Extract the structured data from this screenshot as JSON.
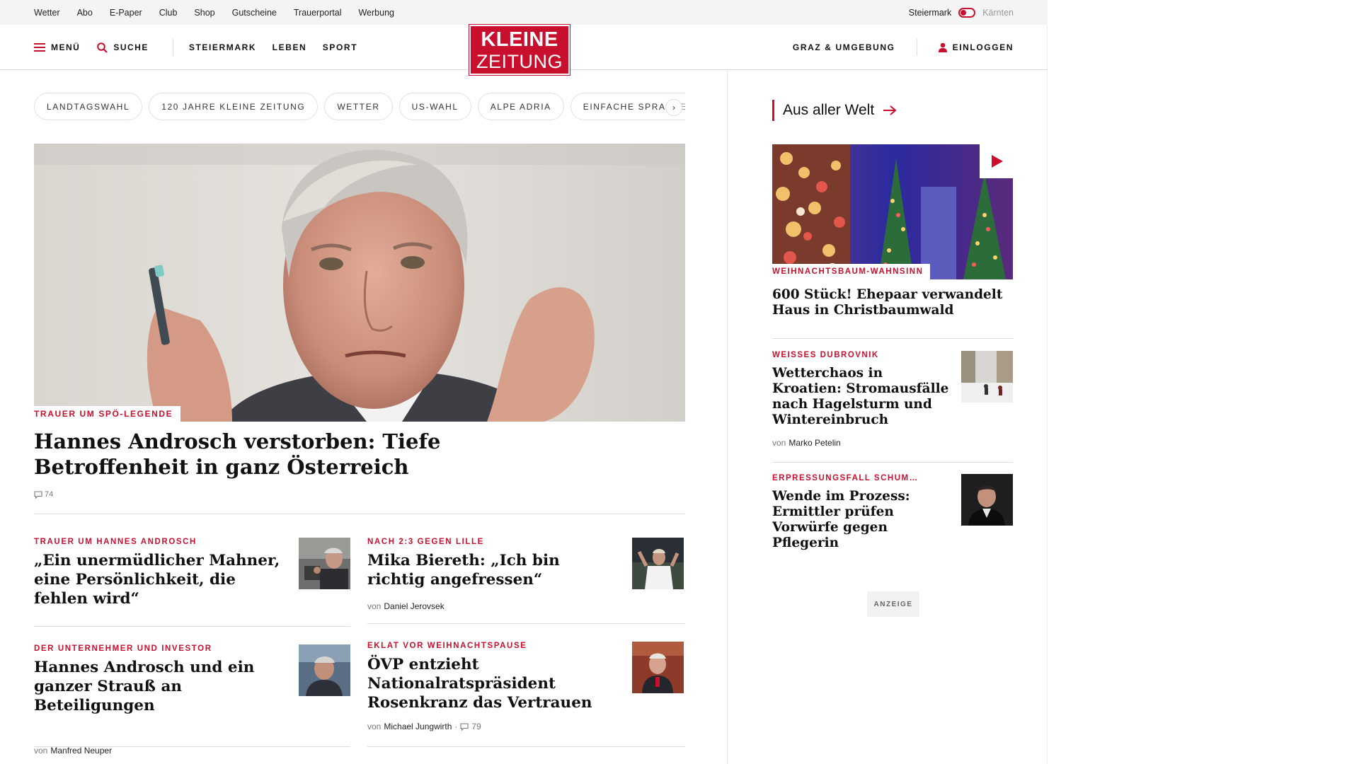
{
  "topbar": {
    "links": [
      "Wetter",
      "Abo",
      "E-Paper",
      "Club",
      "Shop",
      "Gutscheine",
      "Trauerportal",
      "Werbung"
    ],
    "region_active": "Steiermark",
    "region_inactive": "Kärnten"
  },
  "header": {
    "menu_label": "MENÜ",
    "search_label": "SUCHE",
    "nav": [
      "STEIERMARK",
      "LEBEN",
      "SPORT"
    ],
    "region_link": "GRAZ & UMGEBUNG",
    "login_label": "EINLOGGEN",
    "logo_line1": "KLEINE",
    "logo_line2": "ZEITUNG"
  },
  "topics": [
    "LANDTAGSWAHL",
    "120 JAHRE KLEINE ZEITUNG",
    "WETTER",
    "US-WAHL",
    "ALPE ADRIA",
    "EINFACHE SPRACHE"
  ],
  "topics_next": "›",
  "hero": {
    "kicker": "TRAUER UM SPÖ-LEGENDE",
    "title": "Hannes Androsch verstorben: Tiefe Betroffenheit in ganz Österreich",
    "comments": "74"
  },
  "teasers": [
    {
      "kicker": "TRAUER UM HANNES ANDROSCH",
      "title": "„Ein unermüdlicher Mahner, eine Persönlichkeit, die fehlen wird“",
      "author_prefix": "",
      "author": "",
      "comments": ""
    },
    {
      "kicker": "NACH 2:3 GEGEN LILLE",
      "title": "Mika Biereth: „Ich bin richtig angefressen“",
      "author_prefix": "von",
      "author": "Daniel Jerovsek",
      "comments": ""
    },
    {
      "kicker": "DER UNTERNEHMER UND INVESTOR",
      "title": "Hannes Androsch und ein ganzer Strauß an Beteiligungen",
      "author_prefix": "von",
      "author": "Manfred Neuper",
      "comments": ""
    },
    {
      "kicker": "EKLAT VOR WEIHNACHTSPAUSE",
      "title": "ÖVP entzieht Nationalratspräsident Rosenkranz das Vertrauen",
      "author_prefix": "von",
      "author": "Michael Jungwirth",
      "comments": "79"
    }
  ],
  "sidebar": {
    "heading": "Aus aller Welt",
    "lead": {
      "kicker": "WEIHNACHTSBAUM-WAHNSINN",
      "title": "600 Stück! Ehepaar verwandelt Haus in Christbaumwald"
    },
    "items": [
      {
        "kicker": "WEISSES DUBROVNIK",
        "title": "Wetterchaos in Kroatien: Stromausfälle nach Hagelsturm und Wintereinbruch",
        "author_prefix": "von",
        "author": "Marko Petelin"
      },
      {
        "kicker": "ERPRESSUNGSFALL SCHUM…",
        "title": "Wende im Prozess: Ermittler prüfen Vorwürfe gegen Pflegerin"
      }
    ],
    "ad_label": "ANZEIGE"
  },
  "colors": {
    "brand": "#c8102e",
    "text": "#111111",
    "muted": "#777777"
  }
}
